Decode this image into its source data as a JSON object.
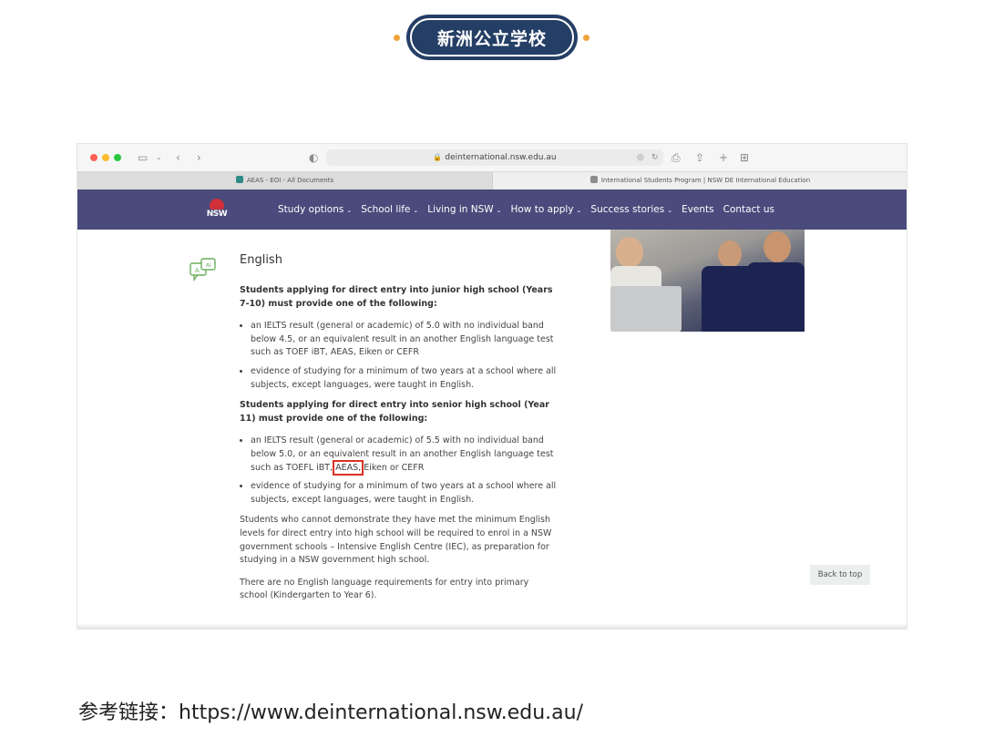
{
  "badge": {
    "title": "新洲公立学校"
  },
  "browser": {
    "url": "deinternational.nsw.edu.au",
    "tabs": [
      {
        "label": "AEAS - EOI - All Documents"
      },
      {
        "label": "International Students Program | NSW DE International Education"
      }
    ]
  },
  "site": {
    "logo_text": "NSW",
    "nav": [
      {
        "label": "Study options",
        "chevron": true
      },
      {
        "label": "School life",
        "chevron": true
      },
      {
        "label": "Living in NSW",
        "chevron": true
      },
      {
        "label": "How to apply",
        "chevron": true
      },
      {
        "label": "Success stories",
        "chevron": true
      },
      {
        "label": "Events",
        "chevron": false
      },
      {
        "label": "Contact us",
        "chevron": false
      }
    ]
  },
  "content": {
    "title": "English",
    "junior_intro": "Students applying for direct entry into junior high school (Years 7-10) must provide one of the following:",
    "junior_items": [
      "an IELTS result (general or academic) of 5.0 with no individual band below 4.5, or an equivalent result in an another English language test such as TOEF iBT, AEAS, Eiken or CEFR",
      "evidence of studying for a minimum of two years at a school where all subjects, except languages, were taught in English."
    ],
    "senior_intro": "Students applying for direct entry into senior high school (Year 11) must provide one of the following:",
    "senior_item1_before": "an IELTS result (general or academic) of 5.5 with no individual band below 5.0, or an equivalent result in an another English language test such as TOEFL iBT,",
    "senior_item1_highlight": "AEAS,",
    "senior_item1_after": "Eiken or CEFR",
    "senior_item2": "evidence of studying for a minimum of two years at a school where all subjects, except languages, were taught in English.",
    "para1": "Students who cannot demonstrate they have met the minimum English levels for direct entry into high school will be required to enrol in a NSW government schools – Intensive English Centre (IEC), as preparation for studying in a NSW government high school.",
    "para2": "There are no English language requirements for entry into primary school (Kindergarten to Year 6).",
    "back_to_top": "Back to top"
  },
  "caption": "参考链接：https://www.deinternational.nsw.edu.au/",
  "colors": {
    "badge": "#243e66",
    "dots": "#f0a23b",
    "nav": "#4a4a7c",
    "highlight": "#d93025"
  }
}
